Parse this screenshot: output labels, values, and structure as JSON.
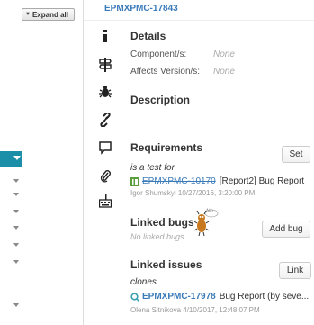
{
  "left_pane": {
    "expand_all_label": "Expand all"
  },
  "issue": {
    "key": "EPMXPMC-17843"
  },
  "side_icons": [
    "info-icon",
    "signpost-icon",
    "bug-icon",
    "link-icon",
    "comment-icon",
    "attachment-icon",
    "keyboard-icon"
  ],
  "details": {
    "title": "Details",
    "components_label": "Component/s:",
    "components_value": "None",
    "affects_label": "Affects Version/s:",
    "affects_value": "None"
  },
  "description": {
    "title": "Description"
  },
  "requirements": {
    "title": "Requirements",
    "button_label": "Set",
    "relation": "is a test for",
    "item_key": "EPMXPMC-10170",
    "item_text": "[Report2] Bug Report",
    "item_meta": "Igor Shumskyi 10/27/2016, 3:20:00 PM"
  },
  "linked_bugs": {
    "title": "Linked bugs",
    "button_label": "Add bug",
    "empty_text": "No linked bugs",
    "bubble_text": "No"
  },
  "linked_issues": {
    "title": "Linked issues",
    "button_label": "Link",
    "relation": "clones",
    "item_key": "EPMXPMC-17978",
    "item_text": "Bug Report (by seve...",
    "item_meta": "Olena Sitnikova 4/10/2017, 12:48:07 PM"
  },
  "colors": {
    "accent": "#1a8fa7",
    "link": "#3a7ab8",
    "muted": "#999999"
  }
}
